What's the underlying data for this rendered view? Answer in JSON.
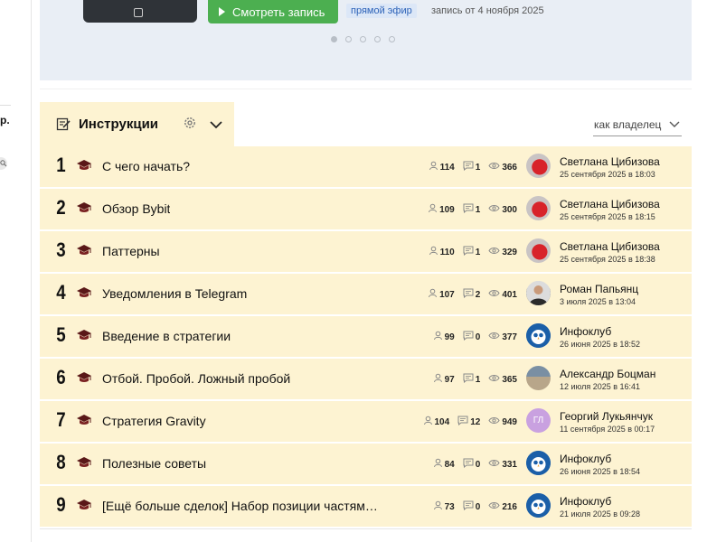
{
  "left_fragment": "р.",
  "banner": {
    "watch_button": "Смотреть запись",
    "live_badge": "прямой эфир",
    "record_date": "запись от 4 ноября 2025",
    "dots_count": 5,
    "active_dot": 0
  },
  "tab": {
    "title": "Инструкции"
  },
  "owner_filter": {
    "selected": "как владелец"
  },
  "rows": [
    {
      "num": "1",
      "title": "С чего начать?",
      "users": "114",
      "comments": "1",
      "views": "366",
      "owner": "Светлана Цибизова",
      "date": "25 сентября 2025 в 18:03",
      "avatar": "red"
    },
    {
      "num": "2",
      "title": "Обзор Bybit",
      "users": "109",
      "comments": "1",
      "views": "300",
      "owner": "Светлана Цибизова",
      "date": "25 сентября 2025 в 18:15",
      "avatar": "red"
    },
    {
      "num": "3",
      "title": "Паттерны",
      "users": "110",
      "comments": "1",
      "views": "329",
      "owner": "Светлана Цибизова",
      "date": "25 сентября 2025 в 18:38",
      "avatar": "red"
    },
    {
      "num": "4",
      "title": "Уведомления в Telegram",
      "users": "107",
      "comments": "2",
      "views": "401",
      "owner": "Роман Папьянц",
      "date": "3 июля 2025 в 13:04",
      "avatar": "man"
    },
    {
      "num": "5",
      "title": "Введение в стратегии",
      "users": "99",
      "comments": "0",
      "views": "377",
      "owner": "Инфоклуб",
      "date": "26 июня 2025 в 18:52",
      "avatar": "club"
    },
    {
      "num": "6",
      "title": "Отбой. Пробой. Ложный пробой",
      "users": "97",
      "comments": "1",
      "views": "365",
      "owner": "Александр Боцман",
      "date": "12 июля 2025 в 16:41",
      "avatar": "sea"
    },
    {
      "num": "7",
      "title": "Стратегия Gravity",
      "users": "104",
      "comments": "12",
      "views": "949",
      "owner": "Георгий Лукьянчук",
      "date": "11 сентября 2025 в 00:17",
      "avatar": "gl",
      "avatar_text": "ГЛ"
    },
    {
      "num": "8",
      "title": "Полезные советы",
      "users": "84",
      "comments": "0",
      "views": "331",
      "owner": "Инфоклуб",
      "date": "26 июня 2025 в 18:54",
      "avatar": "club"
    },
    {
      "num": "9",
      "title": "[Ещё больше сделок] Набор позиции частям…",
      "users": "73",
      "comments": "0",
      "views": "216",
      "owner": "Инфоклуб",
      "date": "21 июля 2025 в 09:28",
      "avatar": "club"
    }
  ],
  "colors": {
    "row_bg": "#fdf3d2",
    "banner_bg": "#e9eef5",
    "button_green": "#4caf50",
    "badge_blue": "#2c62b8"
  }
}
